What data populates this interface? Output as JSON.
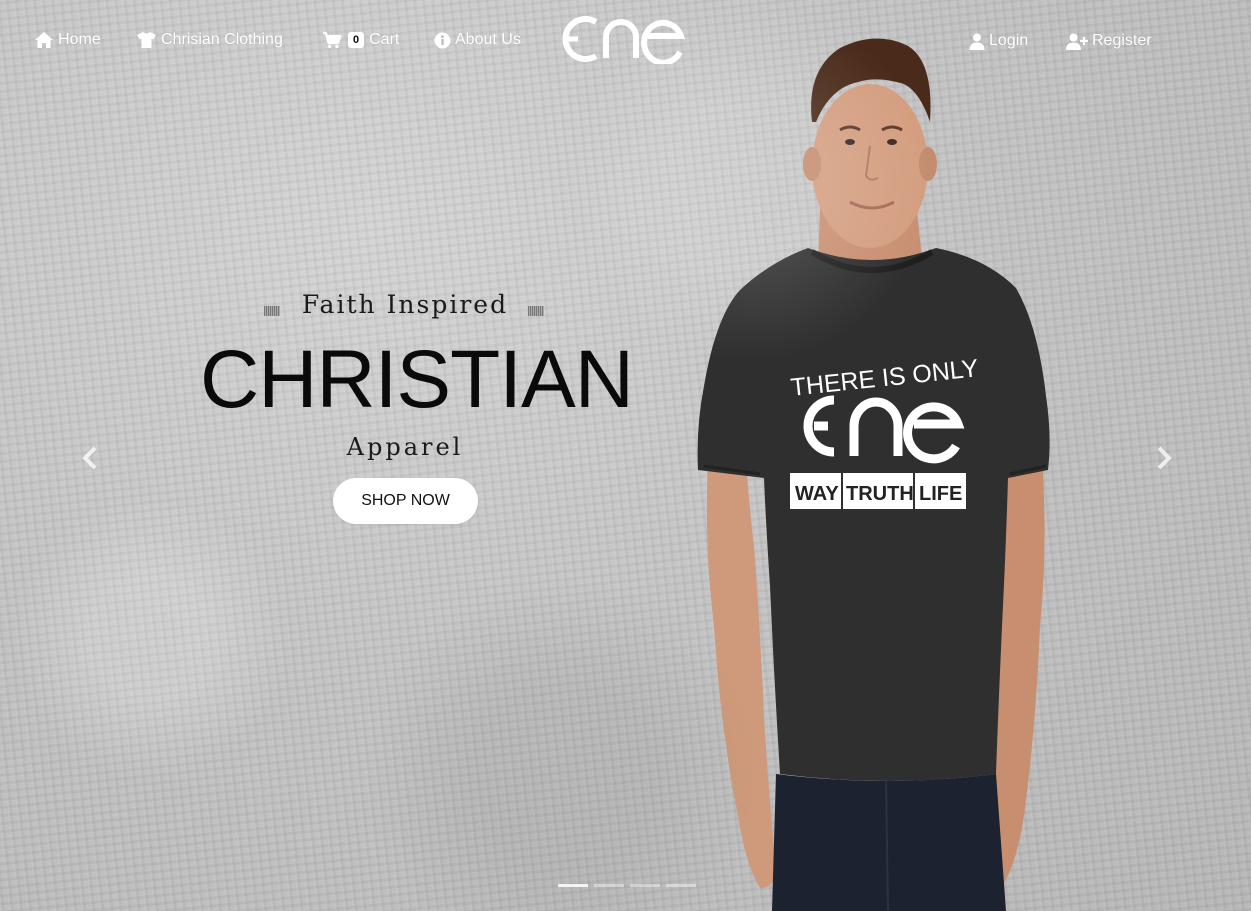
{
  "nav": {
    "home": "Home",
    "clothing": "Chrisian Clothing",
    "cart_count": "0",
    "cart": "Cart",
    "about": "About Us",
    "login": "Login",
    "register": "Register"
  },
  "slide": {
    "kicker": "Faith Inspired",
    "headline": "CHRISTIAN",
    "subline": "Apparel",
    "button": "SHOP NOW",
    "shirt_line1": "THERE IS ONLY",
    "shirt_line2": "WAY",
    "shirt_line3": "TRUTH",
    "shirt_line4": "LIFE"
  },
  "carousel": {
    "slide_count": 4,
    "active_index": 0
  },
  "colors": {
    "nav_text": "#ffffff",
    "headline": "#0a0a0a",
    "button_bg": "#ffffff",
    "shirt": "#2f2f2f"
  },
  "icons": [
    "home-icon",
    "tshirt-icon",
    "cart-icon",
    "info-icon",
    "user-icon",
    "user-plus-icon",
    "chevron-left-icon",
    "chevron-right-icon"
  ]
}
